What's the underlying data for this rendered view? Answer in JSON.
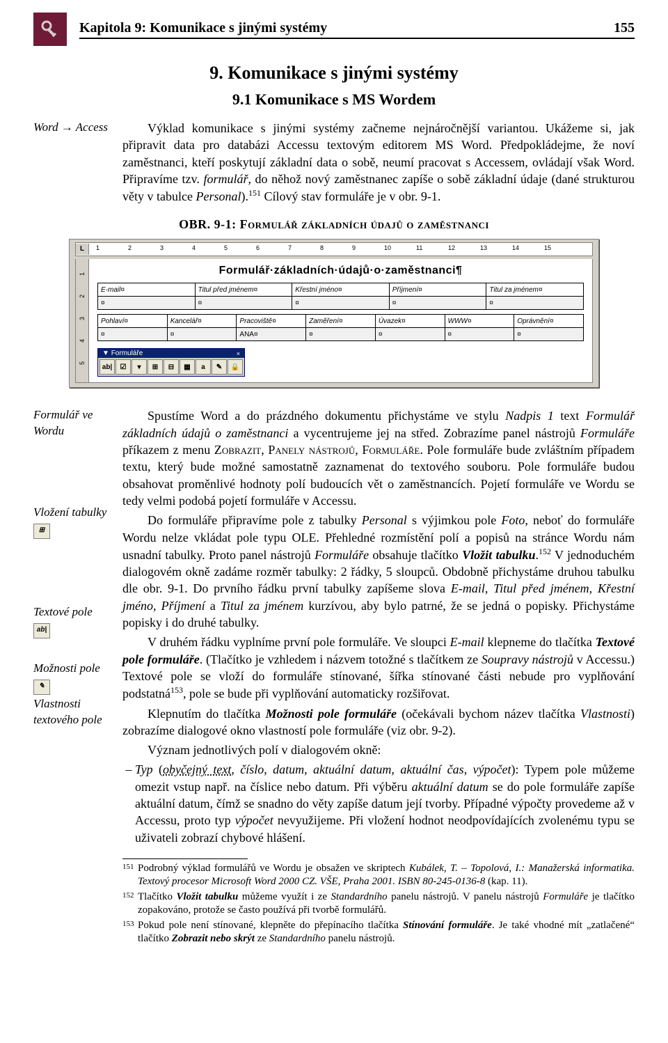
{
  "header": {
    "chapter": "Kapitola 9: Komunikace s jinými systémy",
    "page_number": "155"
  },
  "title": "9. Komunikace s jinými systémy",
  "subtitle": "9.1 Komunikace s MS Wordem",
  "margin_notes": {
    "n1": "Word → Access",
    "n2": "Formulář ve Wordu",
    "n3": "Vložení tabulky",
    "n4": "Textové pole",
    "n5": "Možnosti pole",
    "n6": "Vlastnosti textového pole"
  },
  "para1_a": "Výklad komunikace s jinými systémy začneme nejnáročnější variantou. Ukážeme si, jak připravit data pro databázi Accessu textovým editorem MS Word. Předpokládejme, že noví zaměstnanci, kteří poskytují základní data o sobě, neumí pracovat s Accessem, ovládají však Word. Připravíme tzv. ",
  "para1_b": "formulář",
  "para1_c": ", do něhož nový zaměstnanec zapíše o sobě základní údaje (dané strukturou věty v tabulce ",
  "para1_d": "Personal",
  "para1_e": ").",
  "para1_sup": "151",
  "para1_f": " Cílový stav formuláře je v obr. 9-1.",
  "obr_caption": "OBR. 9-1: Formulář základních údajů o zaměstnanci",
  "screenshot": {
    "doc_title": "Formulář·základních·údajů·o·zaměstnanci",
    "ruler_L": "L",
    "ruler_numbers": [
      "1",
      "2",
      "3",
      "4",
      "5",
      "6",
      "7",
      "8",
      "9",
      "10",
      "11",
      "12",
      "13",
      "14",
      "15"
    ],
    "tbl1": {
      "headers": [
        "E-mail",
        "Titul před jménem",
        "Křestní jméno",
        "Příjmení",
        "Titul za jménem"
      ]
    },
    "tbl2": {
      "headers": [
        "Pohlaví",
        "Kancelář",
        "Pracoviště",
        "Zaměření",
        "Úvazek",
        "WWW",
        "Oprávnění"
      ],
      "row2_val3": "ANA"
    },
    "toolbar_title": "Formuláře",
    "toolbar_btns": [
      "ab|",
      "☑",
      "▾",
      "⊞",
      "⊟",
      "▦",
      "a",
      "✎",
      "🔒"
    ]
  },
  "para2_a": "Spustíme Word a do prázdného dokumentu přichystáme ve stylu ",
  "para2_b": "Nadpis 1",
  "para2_c": " text ",
  "para2_d": "Formulář základních údajů o zaměstnanci",
  "para2_e": " a vycentrujeme jej na střed. Zobrazíme panel nástrojů ",
  "para2_f": "Formuláře",
  "para2_g": " příkazem z menu ",
  "para2_h": "Zobrazit, Panely nástrojů, Formuláře",
  "para2_i": ". Pole formuláře bude zvláštním případem textu, který bude možné samostatně zaznamenat do textového souboru. Pole formuláře budou obsahovat proměnlivé hodnoty polí budoucích vět o zaměstnancích. Pojetí formuláře ve Wordu se tedy velmi podobá pojetí formuláře v Accessu.",
  "para3_a": "Do formuláře připravíme pole z tabulky ",
  "para3_b": "Personal",
  "para3_c": " s výjimkou pole ",
  "para3_d": "Foto",
  "para3_e": ", neboť do formuláře Wordu nelze vkládat pole typu OLE. Přehledné rozmístění polí a popisů na stránce Wordu nám usnadní tabulky. Proto panel nástrojů ",
  "para3_f": "Formuláře",
  "para3_g": " obsahuje tlačítko ",
  "para3_h": "Vložit tabulku",
  "para3_i": ".",
  "para3_sup": "152",
  "para3_j": " V jednoduchém dialogovém okně zadáme rozměr tabulky: 2 řádky, 5 sloupců. Obdobně přichystáme druhou tabulku dle obr. 9-1. Do prvního řádku první tabulky zapíšeme slova ",
  "para3_k": "E-mail, Titul před jménem, Křestní jméno, Příjmení",
  "para3_l": " a ",
  "para3_m": "Titul za jménem",
  "para3_n": " kurzívou, aby bylo patrné, že se jedná o popisky. Přichystáme popisky i do druhé tabulky.",
  "para4_a": "V druhém řádku vyplníme první pole formuláře. Ve sloupci ",
  "para4_b": "E-mail",
  "para4_c": " klepneme do tlačítka ",
  "para4_d": "Textové pole formuláře",
  "para4_e": ". (Tlačítko je vzhledem i názvem totožné s tlačítkem ze ",
  "para4_f": "Soupravy nástrojů",
  "para4_g": " v Accessu.) Textové pole se vloží do formuláře stínované, šířka stínované části nebude pro vyplňování podstatná",
  "para4_sup": "153",
  "para4_h": ", pole se bude při vyplňování automaticky rozšiřovat.",
  "para5_a": "Klepnutím do tlačítka ",
  "para5_b": "Možnosti pole formuláře",
  "para5_c": " (očekávali bychom název tlačítka ",
  "para5_d": "Vlastnosti",
  "para5_e": ") zobrazíme dialogové okno vlastností pole formuláře (viz obr. 9-2).",
  "para6": "Význam jednotlivých polí v dialogovém okně:",
  "bullet1_a": "Typ",
  "bullet1_b": " (",
  "bullet1_c": "obyčejný text",
  "bullet1_d": ", ",
  "bullet1_e": "číslo",
  "bullet1_f": ", ",
  "bullet1_g": "datum",
  "bullet1_h": ", ",
  "bullet1_i": "aktuální datum",
  "bullet1_j": ", ",
  "bullet1_k": "aktuální čas",
  "bullet1_l": ", ",
  "bullet1_m": "výpočet",
  "bullet1_n": "): Typem pole můžeme omezit vstup např. na číslice nebo datum. Při výběru ",
  "bullet1_o": "aktuální datum",
  "bullet1_p": " se do pole formuláře zapíše aktuální datum, čímž se snadno do věty zapíše datum její tvorby. Případné výpočty provedeme až v Accessu, proto typ ",
  "bullet1_q": "výpočet",
  "bullet1_r": " nevyužijeme. Při vložení hodnot neodpovídajících zvolenému typu se uživateli zobrazí chybové hlášení.",
  "footnotes": {
    "f151_a": "Podrobný výklad formulářů ve Wordu je obsažen ve skriptech ",
    "f151_b": "Kubálek, T. – Topolová, I.: Manažerská informatika. Textový procesor Microsoft Word 2000 CZ. VŠE, Praha 2001. ISBN 80-245-0136-8",
    "f151_c": " (kap. 11).",
    "f152_a": "Tlačítko ",
    "f152_b": "Vložit tabulku",
    "f152_c": " můžeme využít i ze ",
    "f152_d": "Standardního",
    "f152_e": " panelu nástrojů. V panelu nástrojů ",
    "f152_f": "Formuláře",
    "f152_g": " je tlačítko zopakováno, protože se často používá při tvorbě formulářů.",
    "f153_a": "Pokud pole není stínované, klepněte do přepínacího tlačítka ",
    "f153_b": "Stínování formuláře",
    "f153_c": ". Je také vhodné mít „zatlačené“ tlačítko ",
    "f153_d": "Zobrazit nebo skrýt",
    "f153_e": " ze ",
    "f153_f": "Standardního",
    "f153_g": " panelu nástrojů."
  },
  "icon_labels": {
    "insert_table": "⊞",
    "text_field": "ab|",
    "field_options": "✎"
  }
}
